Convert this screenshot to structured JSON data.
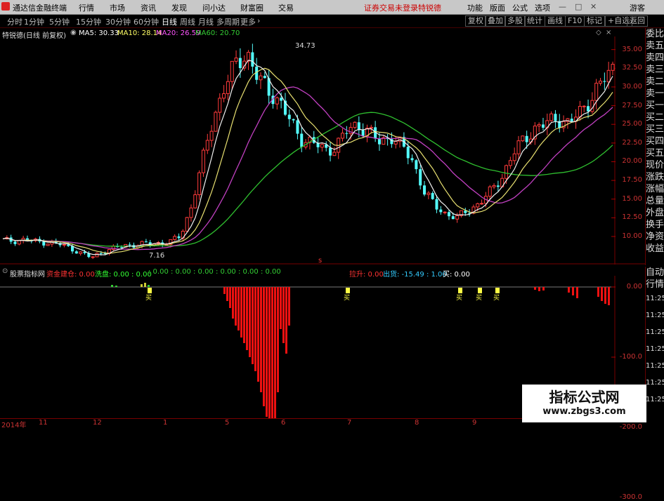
{
  "menubar": {
    "app_title": "通达信金融终端",
    "items": [
      "行情",
      "市场",
      "资讯",
      "发现",
      "问小达",
      "财富圈",
      "交易"
    ],
    "status": "证券交易未登录",
    "stock": "特锐德",
    "right": [
      "功能",
      "版面",
      "公式",
      "选项"
    ],
    "guest": "游客"
  },
  "toolbar": {
    "periods": [
      "分时",
      "1分钟",
      "5分钟",
      "15分钟",
      "30分钟",
      "60分钟",
      "日线",
      "周线",
      "月线",
      "多周期",
      "更多"
    ],
    "active_period": "日线",
    "buttons": [
      "复权",
      "叠加",
      "多股",
      "统计",
      "画线",
      "F10",
      "标记",
      "+自选",
      "返回"
    ]
  },
  "main_chart": {
    "title": "特锐德(日线 前复权)",
    "ma": [
      {
        "label": "MA5: 30.33",
        "color": "#ffffff"
      },
      {
        "label": "MA10: 28.14",
        "color": "#ffff66"
      },
      {
        "label": "MA20: 26.59",
        "color": "#ff55ff"
      },
      {
        "label": "MA60: 20.70",
        "color": "#33cc33"
      }
    ],
    "high_label": "34.73",
    "low_label": "7.16",
    "y_ticks": [
      "35.00",
      "32.50",
      "30.00",
      "27.50",
      "25.00",
      "22.50",
      "20.00",
      "17.50",
      "15.00",
      "12.50",
      "10.00"
    ]
  },
  "indicator": {
    "name": "股票指标网",
    "labels": [
      {
        "text": "资金建仓: 0.00",
        "color": "#ff3333"
      },
      {
        "text": "洗盘: 0.00 : 0.00",
        "color": "#33ff33"
      },
      {
        "text": ": 0.00 : 0.00 : 0.00 : 0.00 : 0.00 : 0.00",
        "color": "#33cc33"
      },
      {
        "text": "拉升: 0.00",
        "color": "#ff3333"
      },
      {
        "text": "出货: -15.49 : 1.00",
        "color": "#33ccff"
      },
      {
        "text": "买: 0.00",
        "color": "#ffffff"
      }
    ],
    "y_ticks": [
      "0.00",
      "-100.0",
      "-200.0",
      "-300.0"
    ],
    "buy_marks": [
      "买",
      "买",
      "买",
      "买",
      "买"
    ]
  },
  "x_axis": [
    "2014年",
    "11",
    "12",
    "1",
    "5",
    "6",
    "7",
    "8",
    "9"
  ],
  "side_panel": [
    "委比",
    "卖五",
    "卖四",
    "卖三",
    "卖二",
    "卖一",
    "买一",
    "买二",
    "买三",
    "买四",
    "买五",
    "现价",
    "涨跌",
    "涨幅",
    "总量",
    "外盘",
    "换手",
    "净资",
    "收益"
  ],
  "side_panel2": [
    "自动",
    "行情"
  ],
  "side_time": [
    "11:25",
    "11:25",
    "11:25",
    "11:25",
    "11:25",
    "11:25",
    "11:25"
  ],
  "watermark": {
    "line1": "指标公式网",
    "line2": "www.zbgs3.com"
  },
  "chart_data": {
    "type": "candlestick",
    "y_range": [
      7,
      36
    ],
    "ma_values": {
      "MA5": 30.33,
      "MA10": 28.14,
      "MA20": 26.59,
      "MA60": 20.7
    },
    "close_trend": [
      9.5,
      9.4,
      9.6,
      9.3,
      9.2,
      9.0,
      8.5,
      7.8,
      7.16,
      8.0,
      8.4,
      8.8,
      8.9,
      9.0,
      9.1,
      9.2,
      10.0,
      14.0,
      20.0,
      26.0,
      30.0,
      33.0,
      34.73,
      31.0,
      29.5,
      28.0,
      25.0,
      23.0,
      22.5,
      21.5,
      22.0,
      24.0,
      25.0,
      24.0,
      22.5,
      23.5,
      22.0,
      20.0,
      16.0,
      14.0,
      13.0,
      12.5,
      13.5,
      14.5,
      16.0,
      18.0,
      21.0,
      23.0,
      24.5,
      25.0,
      26.0,
      25.0,
      26.5,
      28.5,
      30.5,
      32.5
    ]
  }
}
